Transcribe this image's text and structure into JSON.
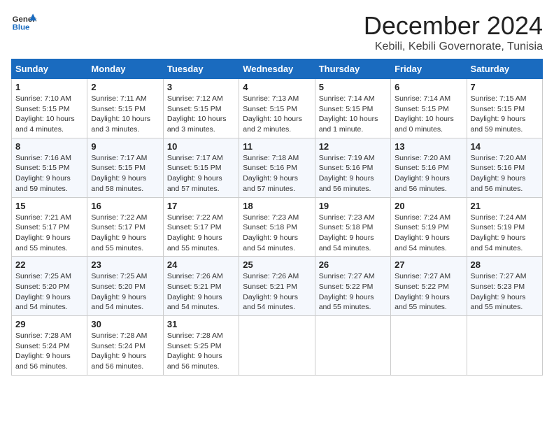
{
  "header": {
    "logo_general": "General",
    "logo_blue": "Blue",
    "month_title": "December 2024",
    "location": "Kebili, Kebili Governorate, Tunisia"
  },
  "weekdays": [
    "Sunday",
    "Monday",
    "Tuesday",
    "Wednesday",
    "Thursday",
    "Friday",
    "Saturday"
  ],
  "weeks": [
    [
      {
        "day": "1",
        "sunrise": "7:10 AM",
        "sunset": "5:15 PM",
        "daylight": "10 hours and 4 minutes."
      },
      {
        "day": "2",
        "sunrise": "7:11 AM",
        "sunset": "5:15 PM",
        "daylight": "10 hours and 3 minutes."
      },
      {
        "day": "3",
        "sunrise": "7:12 AM",
        "sunset": "5:15 PM",
        "daylight": "10 hours and 3 minutes."
      },
      {
        "day": "4",
        "sunrise": "7:13 AM",
        "sunset": "5:15 PM",
        "daylight": "10 hours and 2 minutes."
      },
      {
        "day": "5",
        "sunrise": "7:14 AM",
        "sunset": "5:15 PM",
        "daylight": "10 hours and 1 minute."
      },
      {
        "day": "6",
        "sunrise": "7:14 AM",
        "sunset": "5:15 PM",
        "daylight": "10 hours and 0 minutes."
      },
      {
        "day": "7",
        "sunrise": "7:15 AM",
        "sunset": "5:15 PM",
        "daylight": "9 hours and 59 minutes."
      }
    ],
    [
      {
        "day": "8",
        "sunrise": "7:16 AM",
        "sunset": "5:15 PM",
        "daylight": "9 hours and 59 minutes."
      },
      {
        "day": "9",
        "sunrise": "7:17 AM",
        "sunset": "5:15 PM",
        "daylight": "9 hours and 58 minutes."
      },
      {
        "day": "10",
        "sunrise": "7:17 AM",
        "sunset": "5:15 PM",
        "daylight": "9 hours and 57 minutes."
      },
      {
        "day": "11",
        "sunrise": "7:18 AM",
        "sunset": "5:16 PM",
        "daylight": "9 hours and 57 minutes."
      },
      {
        "day": "12",
        "sunrise": "7:19 AM",
        "sunset": "5:16 PM",
        "daylight": "9 hours and 56 minutes."
      },
      {
        "day": "13",
        "sunrise": "7:20 AM",
        "sunset": "5:16 PM",
        "daylight": "9 hours and 56 minutes."
      },
      {
        "day": "14",
        "sunrise": "7:20 AM",
        "sunset": "5:16 PM",
        "daylight": "9 hours and 56 minutes."
      }
    ],
    [
      {
        "day": "15",
        "sunrise": "7:21 AM",
        "sunset": "5:17 PM",
        "daylight": "9 hours and 55 minutes."
      },
      {
        "day": "16",
        "sunrise": "7:22 AM",
        "sunset": "5:17 PM",
        "daylight": "9 hours and 55 minutes."
      },
      {
        "day": "17",
        "sunrise": "7:22 AM",
        "sunset": "5:17 PM",
        "daylight": "9 hours and 55 minutes."
      },
      {
        "day": "18",
        "sunrise": "7:23 AM",
        "sunset": "5:18 PM",
        "daylight": "9 hours and 54 minutes."
      },
      {
        "day": "19",
        "sunrise": "7:23 AM",
        "sunset": "5:18 PM",
        "daylight": "9 hours and 54 minutes."
      },
      {
        "day": "20",
        "sunrise": "7:24 AM",
        "sunset": "5:19 PM",
        "daylight": "9 hours and 54 minutes."
      },
      {
        "day": "21",
        "sunrise": "7:24 AM",
        "sunset": "5:19 PM",
        "daylight": "9 hours and 54 minutes."
      }
    ],
    [
      {
        "day": "22",
        "sunrise": "7:25 AM",
        "sunset": "5:20 PM",
        "daylight": "9 hours and 54 minutes."
      },
      {
        "day": "23",
        "sunrise": "7:25 AM",
        "sunset": "5:20 PM",
        "daylight": "9 hours and 54 minutes."
      },
      {
        "day": "24",
        "sunrise": "7:26 AM",
        "sunset": "5:21 PM",
        "daylight": "9 hours and 54 minutes."
      },
      {
        "day": "25",
        "sunrise": "7:26 AM",
        "sunset": "5:21 PM",
        "daylight": "9 hours and 54 minutes."
      },
      {
        "day": "26",
        "sunrise": "7:27 AM",
        "sunset": "5:22 PM",
        "daylight": "9 hours and 55 minutes."
      },
      {
        "day": "27",
        "sunrise": "7:27 AM",
        "sunset": "5:22 PM",
        "daylight": "9 hours and 55 minutes."
      },
      {
        "day": "28",
        "sunrise": "7:27 AM",
        "sunset": "5:23 PM",
        "daylight": "9 hours and 55 minutes."
      }
    ],
    [
      {
        "day": "29",
        "sunrise": "7:28 AM",
        "sunset": "5:24 PM",
        "daylight": "9 hours and 56 minutes."
      },
      {
        "day": "30",
        "sunrise": "7:28 AM",
        "sunset": "5:24 PM",
        "daylight": "9 hours and 56 minutes."
      },
      {
        "day": "31",
        "sunrise": "7:28 AM",
        "sunset": "5:25 PM",
        "daylight": "9 hours and 56 minutes."
      },
      null,
      null,
      null,
      null
    ]
  ]
}
